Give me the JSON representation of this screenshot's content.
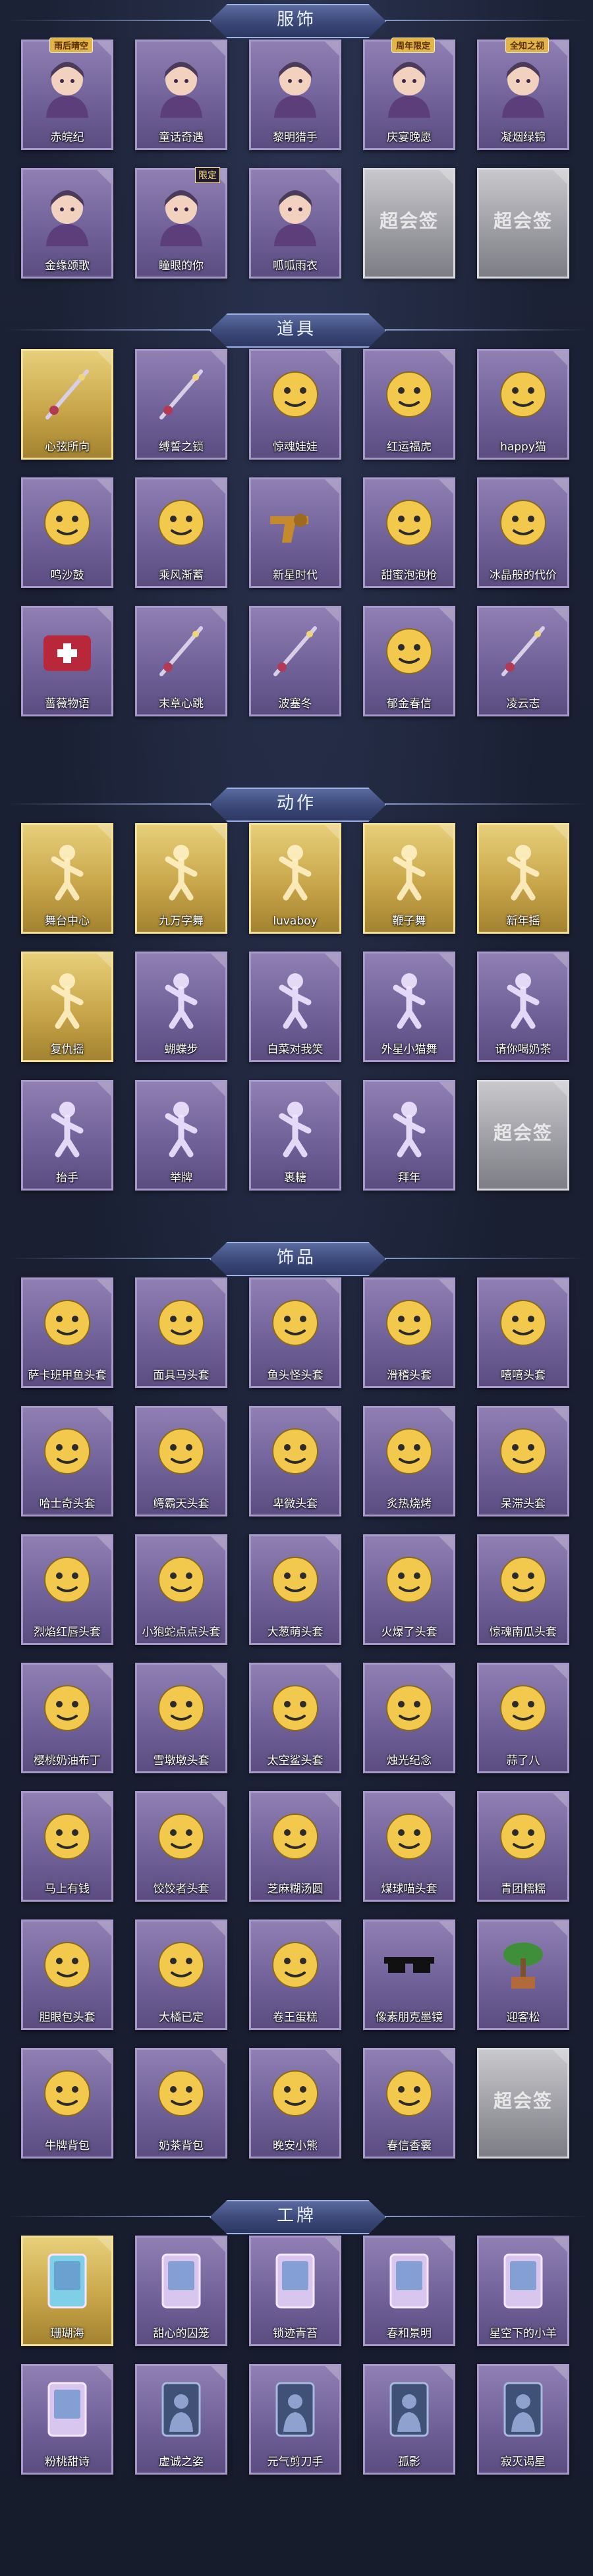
{
  "sections": [
    {
      "key": "clothing",
      "title": "服饰",
      "items": [
        {
          "label": "赤皖纪",
          "style": "purple",
          "icon": "portrait-icon",
          "badge": "雨后晴空"
        },
        {
          "label": "童话奇遇",
          "style": "purple",
          "icon": "portrait-icon"
        },
        {
          "label": "黎明猎手",
          "style": "purple",
          "icon": "portrait-icon"
        },
        {
          "label": "庆宴晚愿",
          "style": "purple",
          "icon": "portrait-icon",
          "badge": "周年限定"
        },
        {
          "label": "凝烟绿锦",
          "style": "purple",
          "icon": "portrait-icon",
          "badge": "全知之视"
        },
        {
          "label": "金缘颂歌",
          "style": "purple",
          "icon": "portrait-icon"
        },
        {
          "label": "瞳眼的你",
          "style": "purple",
          "icon": "portrait-icon",
          "limit": "限定"
        },
        {
          "label": "呱呱雨衣",
          "style": "purple",
          "icon": "portrait-icon"
        },
        {
          "label": "",
          "style": "silver",
          "icon": "placeholder-icon",
          "placeholder": "超会签"
        },
        {
          "label": "",
          "style": "silver",
          "icon": "placeholder-icon",
          "placeholder": "超会签"
        }
      ]
    },
    {
      "key": "props",
      "title": "道具",
      "items": [
        {
          "label": "心弦所向",
          "style": "gold",
          "icon": "necklace-icon"
        },
        {
          "label": "缚誓之锁",
          "style": "purple",
          "icon": "chain-icon"
        },
        {
          "label": "惊魂娃娃",
          "style": "purple",
          "icon": "panda-head-icon"
        },
        {
          "label": "红运福虎",
          "style": "purple",
          "icon": "tiger-icon"
        },
        {
          "label": "happy猫",
          "style": "purple",
          "icon": "cat-icon"
        },
        {
          "label": "鸣沙鼓",
          "style": "purple",
          "icon": "drum-icon"
        },
        {
          "label": "乘风渐蓄",
          "style": "purple",
          "icon": "lantern-icon"
        },
        {
          "label": "新星时代",
          "style": "purple",
          "icon": "revolver-icon"
        },
        {
          "label": "甜蜜泡泡枪",
          "style": "purple",
          "icon": "bubble-gun-icon"
        },
        {
          "label": "冰晶般的代价",
          "style": "purple",
          "icon": "ice-flower-icon"
        },
        {
          "label": "蔷薇物语",
          "style": "purple",
          "icon": "medkit-icon"
        },
        {
          "label": "末章心跳",
          "style": "purple",
          "icon": "scepter-icon"
        },
        {
          "label": "波塞冬",
          "style": "purple",
          "icon": "trident-icon"
        },
        {
          "label": "郁金春信",
          "style": "purple",
          "icon": "fan-icon"
        },
        {
          "label": "凌云志",
          "style": "purple",
          "icon": "sword-icon"
        }
      ]
    },
    {
      "key": "actions",
      "title": "动作",
      "items": [
        {
          "label": "舞台中心",
          "style": "gold",
          "icon": "pose-icon"
        },
        {
          "label": "九万字舞",
          "style": "gold",
          "icon": "pose-icon"
        },
        {
          "label": "luvaboy",
          "style": "gold",
          "icon": "pose-icon"
        },
        {
          "label": "鞭子舞",
          "style": "gold",
          "icon": "pose-icon"
        },
        {
          "label": "新年摇",
          "style": "gold",
          "icon": "pose-icon"
        },
        {
          "label": "复仇摇",
          "style": "gold",
          "icon": "pose-icon"
        },
        {
          "label": "蝴蝶步",
          "style": "purple",
          "icon": "pose-icon"
        },
        {
          "label": "白菜对我笑",
          "style": "purple",
          "icon": "pose-icon"
        },
        {
          "label": "外星小猫舞",
          "style": "purple",
          "icon": "pose-icon"
        },
        {
          "label": "请你喝奶茶",
          "style": "purple",
          "icon": "pose-icon"
        },
        {
          "label": "抬手",
          "style": "purple",
          "icon": "pose-icon"
        },
        {
          "label": "举牌",
          "style": "purple",
          "icon": "pose-icon"
        },
        {
          "label": "裹糖",
          "style": "purple",
          "icon": "pose-icon"
        },
        {
          "label": "拜年",
          "style": "purple",
          "icon": "pose-icon"
        },
        {
          "label": "",
          "style": "silver",
          "icon": "placeholder-icon",
          "placeholder": "超会签"
        }
      ]
    },
    {
      "key": "accessories",
      "title": "饰品",
      "items": [
        {
          "label": "萨卡班甲鱼头套",
          "style": "purple",
          "icon": "fish-head-icon"
        },
        {
          "label": "面具马头套",
          "style": "purple",
          "icon": "horse-head-icon"
        },
        {
          "label": "鱼头怪头套",
          "style": "purple",
          "icon": "fish-face-icon"
        },
        {
          "label": "滑稽头套",
          "style": "purple",
          "icon": "funny-face-icon"
        },
        {
          "label": "嘻嘻头套",
          "style": "purple",
          "icon": "grin-face-icon"
        },
        {
          "label": "哈士奇头套",
          "style": "purple",
          "icon": "husky-icon"
        },
        {
          "label": "鳄霸天头套",
          "style": "purple",
          "icon": "crocodile-icon"
        },
        {
          "label": "卑微头套",
          "style": "purple",
          "icon": "humble-face-icon"
        },
        {
          "label": "炙热烧烤",
          "style": "purple",
          "icon": "toast-icon"
        },
        {
          "label": "呆滞头套",
          "style": "purple",
          "icon": "dull-face-icon"
        },
        {
          "label": "烈焰红唇头套",
          "style": "purple",
          "icon": "lips-icon"
        },
        {
          "label": "小狍蛇点点头套",
          "style": "purple",
          "icon": "snake-icon"
        },
        {
          "label": "大葱萌头套",
          "style": "purple",
          "icon": "onion-icon"
        },
        {
          "label": "火爆了头套",
          "style": "purple",
          "icon": "flame-icon"
        },
        {
          "label": "惊魂南瓜头套",
          "style": "purple",
          "icon": "pumpkin-icon"
        },
        {
          "label": "樱桃奶油布丁",
          "style": "purple",
          "icon": "pudding-icon"
        },
        {
          "label": "雪墩墩头套",
          "style": "purple",
          "icon": "snowman-icon"
        },
        {
          "label": "太空鲨头套",
          "style": "purple",
          "icon": "shark-icon"
        },
        {
          "label": "烛光纪念",
          "style": "purple",
          "icon": "candle-icon"
        },
        {
          "label": "蒜了八",
          "style": "purple",
          "icon": "garlic-icon"
        },
        {
          "label": "马上有钱",
          "style": "purple",
          "icon": "money-horse-icon"
        },
        {
          "label": "饺饺者头套",
          "style": "purple",
          "icon": "dumpling-icon"
        },
        {
          "label": "芝麻糊汤圆",
          "style": "purple",
          "icon": "tangyuan-icon"
        },
        {
          "label": "煤球喵头套",
          "style": "purple",
          "icon": "black-cat-icon"
        },
        {
          "label": "青团糯糯",
          "style": "purple",
          "icon": "qingtuan-icon"
        },
        {
          "label": "胆眼包头套",
          "style": "purple",
          "icon": "bun-icon"
        },
        {
          "label": "大橘已定",
          "style": "purple",
          "icon": "orange-icon"
        },
        {
          "label": "卷王蛋糕",
          "style": "purple",
          "icon": "cake-roll-icon"
        },
        {
          "label": "像素朋克墨镜",
          "style": "purple",
          "icon": "pixel-glasses-icon"
        },
        {
          "label": "迎客松",
          "style": "purple",
          "icon": "bonsai-icon"
        },
        {
          "label": "牛牌背包",
          "style": "purple",
          "icon": "cow-bag-icon"
        },
        {
          "label": "奶茶背包",
          "style": "purple",
          "icon": "qr-bag-icon"
        },
        {
          "label": "晚安小熊",
          "style": "purple",
          "icon": "bear-icon"
        },
        {
          "label": "春信香囊",
          "style": "purple",
          "icon": "sachet-icon"
        },
        {
          "label": "",
          "style": "silver",
          "icon": "placeholder-icon",
          "placeholder": "超会签"
        }
      ]
    },
    {
      "key": "badges",
      "title": "工牌",
      "items": [
        {
          "label": "珊瑚海",
          "style": "gold",
          "icon": "badge-card-icon"
        },
        {
          "label": "甜心的囚笼",
          "style": "purple",
          "icon": "badge-card-icon"
        },
        {
          "label": "锁迹青苔",
          "style": "purple",
          "icon": "badge-card-icon"
        },
        {
          "label": "春和景明",
          "style": "purple",
          "icon": "badge-card-icon"
        },
        {
          "label": "星空下的小羊",
          "style": "purple",
          "icon": "badge-card-icon"
        },
        {
          "label": "粉桃甜诗",
          "style": "purple",
          "icon": "badge-card-icon"
        },
        {
          "label": "虚诚之姿",
          "style": "purple",
          "icon": "silhouette-icon"
        },
        {
          "label": "元气剪刀手",
          "style": "purple",
          "icon": "silhouette-icon"
        },
        {
          "label": "孤影",
          "style": "purple",
          "icon": "silhouette-icon"
        },
        {
          "label": "寂灭谒星",
          "style": "purple",
          "icon": "silhouette-icon"
        }
      ]
    }
  ],
  "colors": {
    "background": "#1a2033",
    "card_purple": "#7a6aa2",
    "card_gold": "#d4b55c",
    "card_silver": "#a3a3aa",
    "header_plate": "#3b4878"
  }
}
